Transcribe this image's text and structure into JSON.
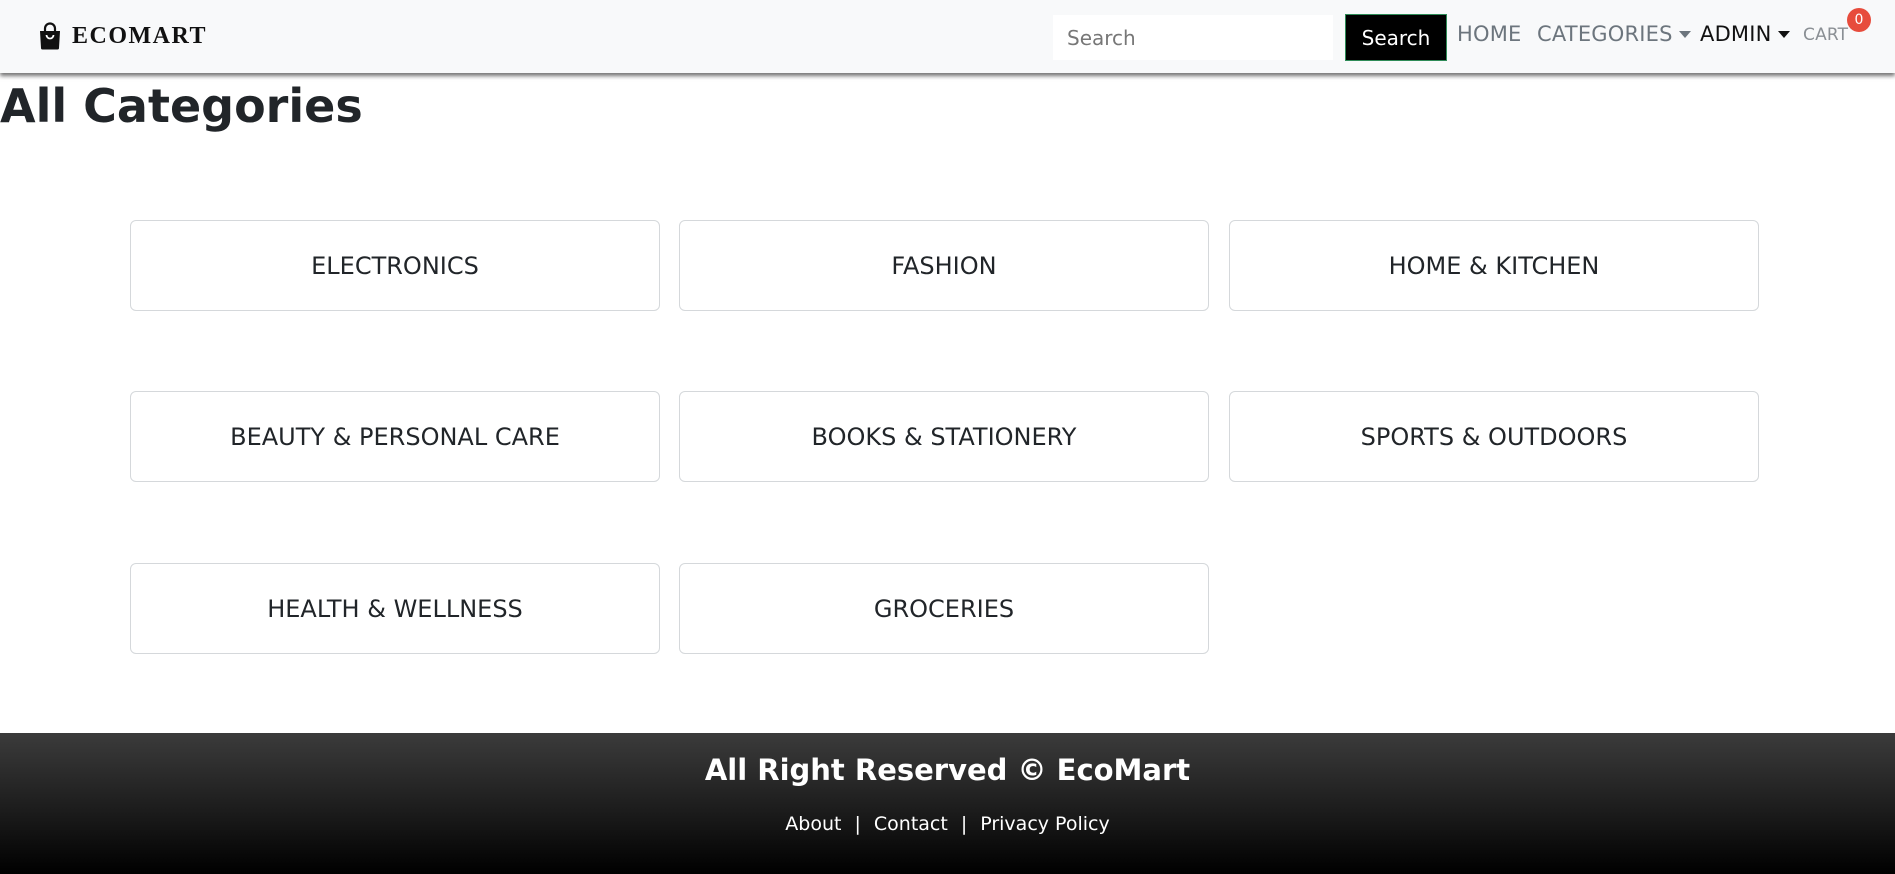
{
  "navbar": {
    "brand": "ECOMART",
    "brand_icon": "shopping-bag-icon",
    "search_placeholder": "Search",
    "search_button": "Search",
    "home": "HOME",
    "categories": "CATEGORIES",
    "admin": "ADMIN",
    "cart": "CART",
    "cart_count": "0",
    "cart_badge_color": "#e74c3c"
  },
  "main": {
    "title": "All Categories",
    "categories": [
      "ELECTRONICS",
      "FASHION",
      "HOME & KITCHEN",
      "BEAUTY & PERSONAL CARE",
      "BOOKS & STATIONERY",
      "SPORTS & OUTDOORS",
      "HEALTH & WELLNESS",
      "GROCERIES"
    ]
  },
  "footer": {
    "copyright": "All Right Reserved © EcoMart",
    "links": [
      "About",
      "Contact",
      "Privacy Policy"
    ],
    "separator": "|"
  }
}
